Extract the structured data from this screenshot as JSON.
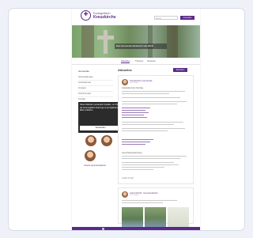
{
  "header": {
    "brand_line1": "Evangelisch",
    "brand_line2": "Kreuzkirche",
    "search_placeholder": "Suche",
    "login_label": "Anmelden"
  },
  "hero": {
    "banner_text": "Das Gemeinde-Netzwerk seit 2018"
  },
  "tabs": [
    {
      "label": "Aktuelles"
    },
    {
      "label": "Themen"
    },
    {
      "label": "Gruppen"
    }
  ],
  "left": {
    "title": "Gemeinde",
    "nav_items": [
      "Veranstaltungen",
      "Gottesdienste",
      "Gruppen",
      "Kirchenmusik",
      "Kontakt"
    ],
    "avatars_label": "Unsere Ansprechpartner"
  },
  "cookie": {
    "text": "Diese Website verwendet Cookies, um Ihnen die bestmögliche Nutzung zu ermöglichen. Mehr erfahren",
    "button_label": "Verstanden"
  },
  "feed": {
    "title": "Aktuelles",
    "write_label": "Schreiben",
    "post1": {
      "author": "Kreuzkirche Gemeinde",
      "time": "vor 2 Tagen",
      "text1": "Gottesdienst am Sonntag",
      "footer": "Gefällt 12 Mal"
    },
    "post1_bottom": {
      "text1": "Gemeindeversammlung",
      "footer": "Antworten · Teilen"
    },
    "post2": {
      "author": "Anna Schulz, Gemeindebüro",
      "time": "vor 5 Tagen",
      "footer": "Gefällt 8 Mal"
    }
  },
  "colors": {
    "accent": "#5b2a86"
  }
}
